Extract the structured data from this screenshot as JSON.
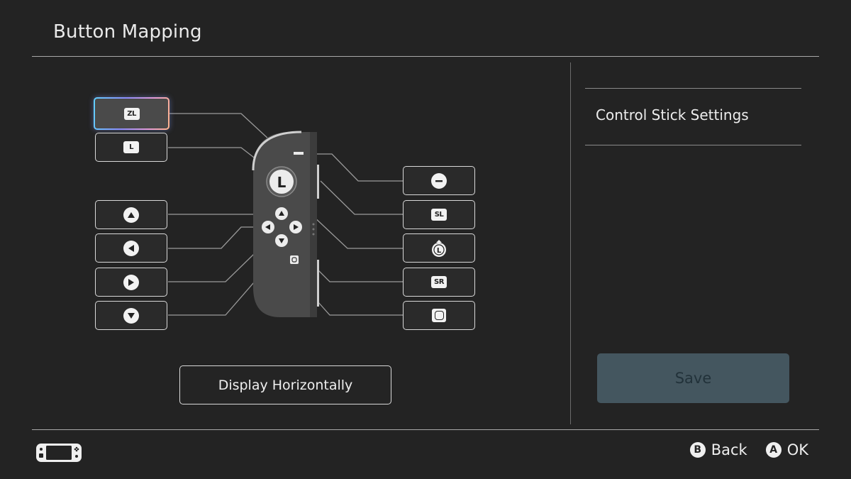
{
  "header": {
    "title": "Button Mapping"
  },
  "mapping": {
    "left_buttons": [
      {
        "label": "ZL",
        "icon": "zl-button-icon",
        "selected": true
      },
      {
        "label": "L",
        "icon": "l-button-icon",
        "selected": false
      },
      {
        "label": "",
        "icon": "up-button-icon",
        "selected": false
      },
      {
        "label": "",
        "icon": "left-button-icon",
        "selected": false
      },
      {
        "label": "",
        "icon": "right-button-icon",
        "selected": false
      },
      {
        "label": "",
        "icon": "down-button-icon",
        "selected": false
      }
    ],
    "right_buttons": [
      {
        "label": "",
        "icon": "minus-button-icon"
      },
      {
        "label": "SL",
        "icon": "sl-button-icon"
      },
      {
        "label": "L",
        "icon": "stick-press-icon"
      },
      {
        "label": "SR",
        "icon": "sr-button-icon"
      },
      {
        "label": "",
        "icon": "capture-button-icon"
      }
    ],
    "joycon": {
      "stick_label": "L"
    },
    "display_toggle_label": "Display Horizontally"
  },
  "sidebar": {
    "items": [
      {
        "label": "Control Stick Settings"
      }
    ],
    "save_label": "Save"
  },
  "footer": {
    "hints": [
      {
        "key": "B",
        "label": "Back"
      },
      {
        "key": "A",
        "label": "OK"
      }
    ]
  },
  "colors": {
    "background": "#232323",
    "save_button": "#44565f",
    "selection_gradient": [
      "#5fd1ff",
      "#8d8dff",
      "#e79bd6",
      "#ffb48a"
    ]
  }
}
